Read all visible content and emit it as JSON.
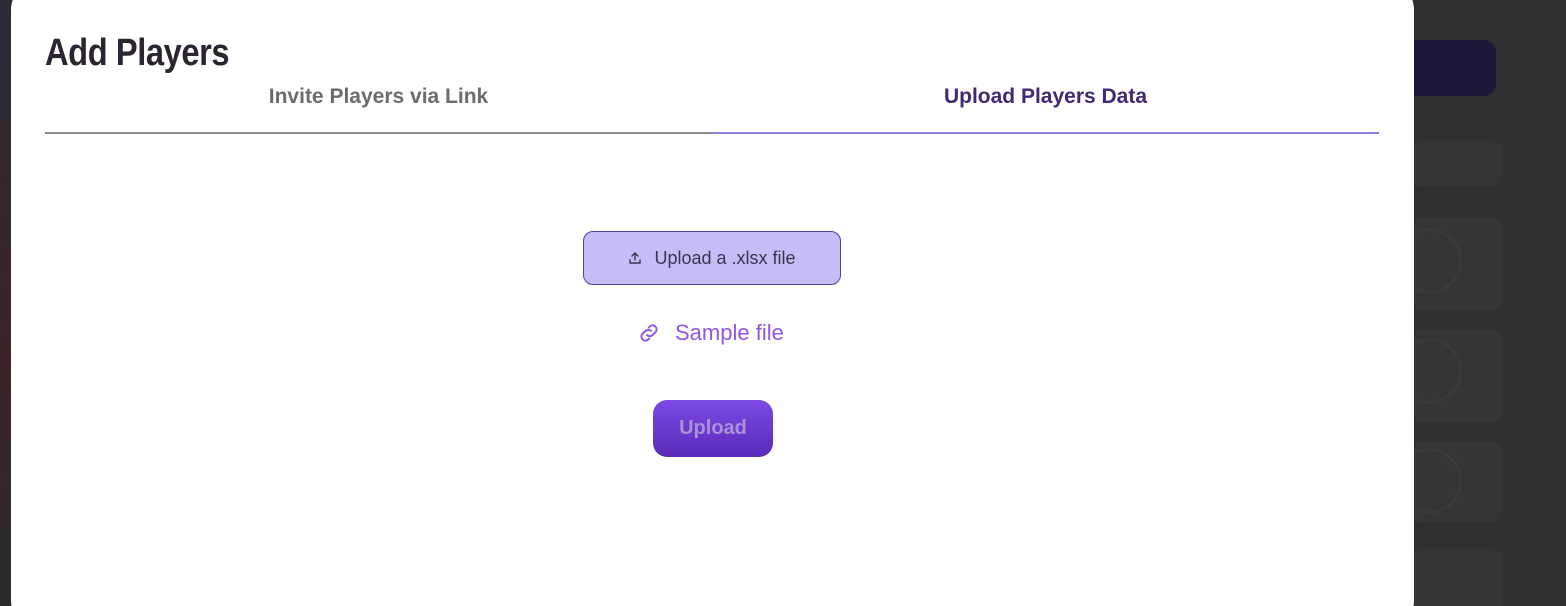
{
  "modal": {
    "title": "Add Players",
    "tabs": [
      {
        "label": "Invite Players via Link",
        "active": false
      },
      {
        "label": "Upload Players Data",
        "active": true
      }
    ]
  },
  "upload_panel": {
    "file_button_label": "Upload a .xlsx file",
    "file_button_icon": "upload-arrow-icon",
    "sample_link_label": "Sample file",
    "sample_link_icon": "link-icon",
    "submit_label": "Upload",
    "submit_disabled": true
  },
  "colors": {
    "accent": "#9256e8",
    "active_tab_text": "#3f2a73",
    "active_tab_underline": "#8f7ee6",
    "file_button_bg": "#c4bdf8",
    "submit_bg": "#6a38d0"
  }
}
